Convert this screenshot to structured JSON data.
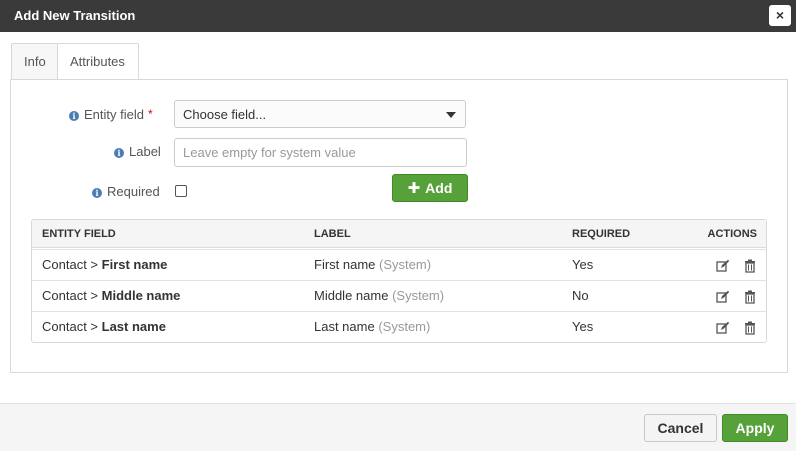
{
  "dialog": {
    "title": "Add New Transition",
    "close_glyph": "×"
  },
  "tabs": [
    {
      "label": "Info",
      "active": false
    },
    {
      "label": "Attributes",
      "active": true
    }
  ],
  "form": {
    "entity_field": {
      "label": "Entity field",
      "required_mark": "*",
      "value": "Choose field..."
    },
    "label_field": {
      "label": "Label",
      "placeholder": "Leave empty for system value"
    },
    "required_field": {
      "label": "Required",
      "checked": false
    },
    "add_button": {
      "icon": "plus-icon",
      "label": "Add"
    }
  },
  "grid": {
    "columns": [
      "ENTITY FIELD",
      "LABEL",
      "REQUIRED",
      "ACTIONS"
    ],
    "rows": [
      {
        "entity_prefix": "Contact >",
        "field": "First name",
        "label": "First name",
        "label_suffix": "(System)",
        "required": "Yes"
      },
      {
        "entity_prefix": "Contact >",
        "field": "Middle name",
        "label": "Middle name",
        "label_suffix": "(System)",
        "required": "No"
      },
      {
        "entity_prefix": "Contact >",
        "field": "Last name",
        "label": "Last name",
        "label_suffix": "(System)",
        "required": "Yes"
      }
    ],
    "action_icons": [
      "edit-icon",
      "trash-icon"
    ]
  },
  "footer": {
    "cancel_label": "Cancel",
    "apply_label": "Apply"
  },
  "colors": {
    "titlebar": "#3a3a3a",
    "primary_green": "#57a13a",
    "info_icon": "#4a7db5",
    "required_star": "#dd0000"
  }
}
